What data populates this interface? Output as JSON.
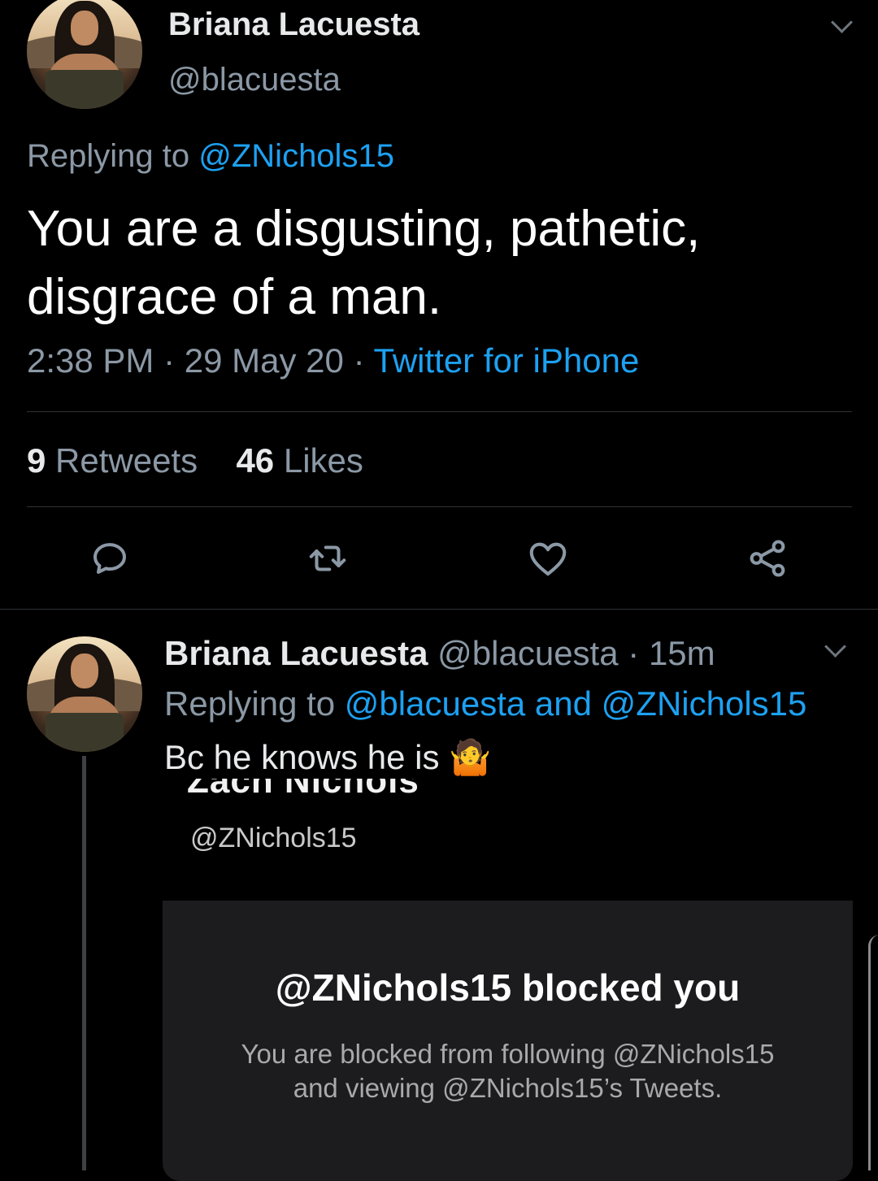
{
  "main_tweet": {
    "author_name": "Briana Lacuesta",
    "author_handle": "@blacuesta",
    "replying_prefix": "Replying to",
    "replying_to": "@ZNichols15",
    "text_line1": "You are a disgusting, pathetic,",
    "text_line2": "disgrace of a man.",
    "time": "2:38 PM",
    "separator": "·",
    "date": "29 May 20",
    "source": "Twitter for iPhone",
    "retweets_count": "9",
    "retweets_label": "Retweets",
    "likes_count": "46",
    "likes_label": "Likes",
    "actions": [
      "reply-icon",
      "retweet-icon",
      "like-icon",
      "share-icon"
    ]
  },
  "reply_tweet": {
    "author_name": "Briana Lacuesta",
    "author_handle": "@blacuesta",
    "separator": "·",
    "age": "15m",
    "replying_prefix": "Replying to",
    "replying_to_1": "@blacuesta",
    "replying_and": "and",
    "replying_to_2": "@ZNichols15",
    "text": "Bc he knows he is 🤷"
  },
  "embedded_screenshot": {
    "profile_name_cut": "Zach Nichols",
    "profile_handle": "@ZNichols15",
    "blocked_title": "@ZNichols15 blocked you",
    "blocked_line1": "You are blocked from following @ZNichols15",
    "blocked_line2": "and viewing @ZNichols15’s Tweets."
  },
  "colors": {
    "background": "#000000",
    "link": "#1da1f2",
    "secondary_text": "#8b98a5",
    "card_bg": "#1c1c1e"
  }
}
